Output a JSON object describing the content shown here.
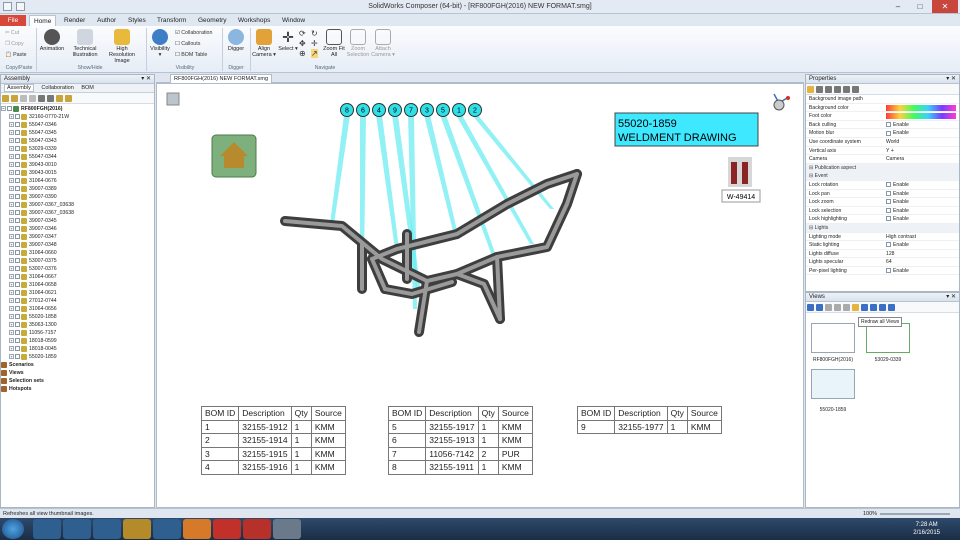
{
  "app": {
    "title": "SolidWorks Composer (64-bit) - [RF800FGH(2016) NEW FORMAT.smg]"
  },
  "tabs": [
    "File",
    "Home",
    "Render",
    "Author",
    "Styles",
    "Transform",
    "Geometry",
    "Workshops",
    "Window"
  ],
  "ribbon": {
    "clipboard": {
      "cut": "Cut",
      "copy": "Copy",
      "paste": "Paste",
      "group": "Copy/Paste"
    },
    "show_hide": {
      "animation": "Animation",
      "tech": "Technical Illustration",
      "hires": "High Resolution Image",
      "group": "Show/Hide"
    },
    "visibility": {
      "visibility": "Visibility",
      "collaboration": "Collaboration",
      "callouts": "Callouts",
      "bom_table": "BOM Table",
      "group": "Visibility"
    },
    "digger": {
      "digger": "Digger",
      "group": "Digger"
    },
    "navigate": {
      "align_camera": "Align Camera",
      "select": "Select",
      "zoom_fit": "Zoom Fit All",
      "zoom_sel": "Zoom Selection",
      "attach": "Attach Camera",
      "group": "Navigate"
    }
  },
  "assembly": {
    "title": "Assembly",
    "tabs": [
      "Assembly",
      "Collaboration",
      "BOM"
    ],
    "root": "RF800FGH(2016)",
    "items": [
      "32160-0770-21W",
      "55047-0346",
      "55047-0345",
      "55047-0343",
      "53029-0339",
      "55047-0344",
      "39043-0010",
      "39043-0015",
      "31064-0676",
      "39007-0389",
      "39007-0390",
      "39007-0367_03638",
      "39007-0367_03638",
      "39007-0345",
      "39007-0346",
      "39007-0347",
      "39007-0348",
      "31064-0660",
      "53007-0375",
      "53007-0376",
      "31064-0667",
      "31064-0658",
      "31064-0621",
      "27012-0744",
      "31064-0656",
      "55020-1858",
      "35063-1300",
      "11056-7157",
      "18018-0599",
      "18018-0045",
      "55020-1859"
    ],
    "sections": [
      "Scenarios",
      "Views",
      "Selection sets",
      "Hotspots"
    ]
  },
  "document": {
    "tab": "RF800FGH(2016) NEW FORMAT.smg",
    "title_line1": "55020-1859",
    "title_line2": "WELDMENT DRAWING",
    "part_label": "W-49414",
    "callouts": [
      "8",
      "6",
      "4",
      "9",
      "7",
      "3",
      "5",
      "1",
      "2"
    ],
    "bom_header": [
      "BOM ID",
      "Description",
      "Qty",
      "Source"
    ],
    "bom_tables": [
      [
        [
          "1",
          "32155-1912",
          "1",
          "KMM"
        ],
        [
          "2",
          "32155-1914",
          "1",
          "KMM"
        ],
        [
          "3",
          "32155-1915",
          "1",
          "KMM"
        ],
        [
          "4",
          "32155-1916",
          "1",
          "KMM"
        ]
      ],
      [
        [
          "5",
          "32155-1917",
          "1",
          "KMM"
        ],
        [
          "6",
          "32155-1913",
          "1",
          "KMM"
        ],
        [
          "7",
          "11056-7142",
          "2",
          "PUR"
        ],
        [
          "8",
          "32155-1911",
          "1",
          "KMM"
        ]
      ],
      [
        [
          "9",
          "32155-1977",
          "1",
          "KMM"
        ]
      ]
    ]
  },
  "properties": {
    "title": "Properties",
    "rows": [
      {
        "k": "Background image path",
        "v": ""
      },
      {
        "k": "Background color",
        "v": ""
      },
      {
        "k": "Foot color",
        "v": ""
      },
      {
        "k": "Back culling",
        "v": "Enable"
      },
      {
        "k": "Motion blur",
        "v": "Enable"
      },
      {
        "k": "Use coordinate system",
        "v": "World"
      },
      {
        "k": "Vertical axis",
        "v": "Y +"
      },
      {
        "k": "Camera",
        "v": "Camera"
      },
      {
        "k": "Publication aspect",
        "v": "",
        "sec": true
      },
      {
        "k": "Event",
        "v": "",
        "sec": true
      },
      {
        "k": "Lock rotation",
        "v": "Enable"
      },
      {
        "k": "Lock pan",
        "v": "Enable"
      },
      {
        "k": "Lock zoom",
        "v": "Enable"
      },
      {
        "k": "Lock selection",
        "v": "Enable"
      },
      {
        "k": "Lock highlighting",
        "v": "Enable"
      },
      {
        "k": "Lights",
        "v": "",
        "sec": true
      },
      {
        "k": "Lighting mode",
        "v": "High contrast"
      },
      {
        "k": "Static lighting",
        "v": "Enable"
      },
      {
        "k": "Lights diffuse",
        "v": "128"
      },
      {
        "k": "Lights specular",
        "v": "64"
      },
      {
        "k": "Per-pixel lighting",
        "v": "Enable"
      }
    ]
  },
  "views": {
    "title": "Views",
    "tooltip": "Redraw all Views",
    "thumbs": [
      "RF800FGH(2016)",
      "53029-0339",
      "55020-1859"
    ]
  },
  "status": {
    "text": "Refreshes all view thumbnail images.",
    "zoom": "100%"
  },
  "clock": {
    "time": "7:28 AM",
    "date": "2/16/2015"
  },
  "colors": {
    "title_box": "#3ee8ff",
    "callout": "#2ee0e8",
    "file_tab": "#d6483a"
  }
}
